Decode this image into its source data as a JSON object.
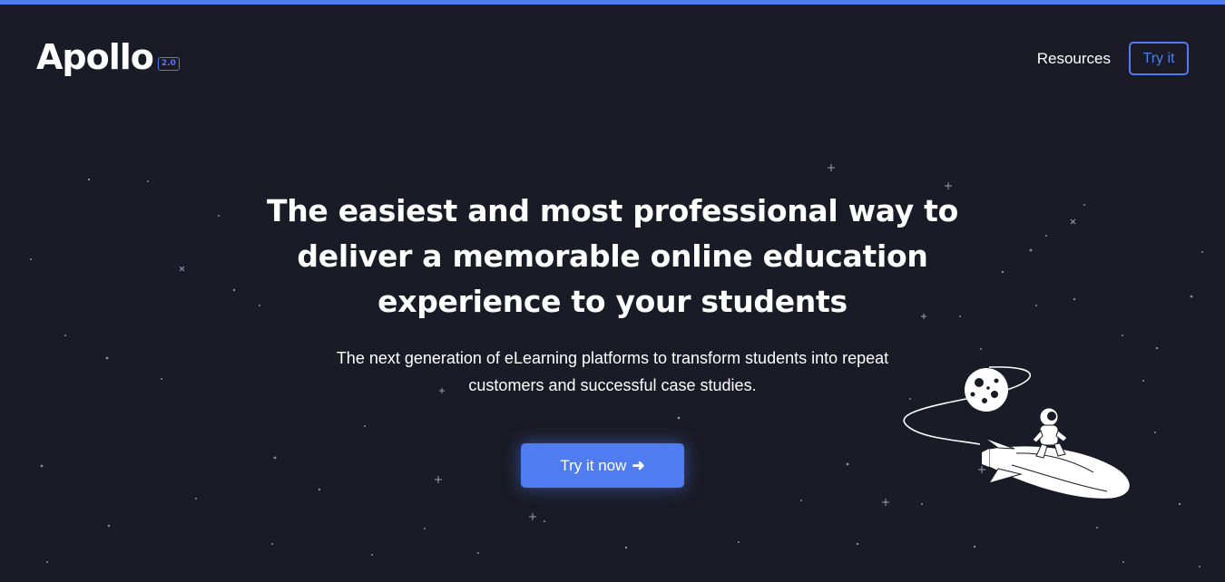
{
  "header": {
    "logo_text": "Apollo",
    "logo_badge": "2.0",
    "nav_resources": "Resources",
    "nav_try": "Try it"
  },
  "hero": {
    "headline_line1": "The easiest and most professional way to",
    "headline_line2": "deliver a memorable online education",
    "headline_line3": "experience to your students",
    "sub_line1": "The next generation of eLearning platforms to transform students into repeat",
    "sub_line2": "customers and successful case studies.",
    "cta_label": "Try it now",
    "cta_icon": "arrow-right-icon"
  },
  "illustration": {
    "icon": "astronaut-rocket-moon-icon"
  },
  "colors": {
    "background": "#1a1b26",
    "accent": "#4f7cf0",
    "text": "#ffffff"
  }
}
